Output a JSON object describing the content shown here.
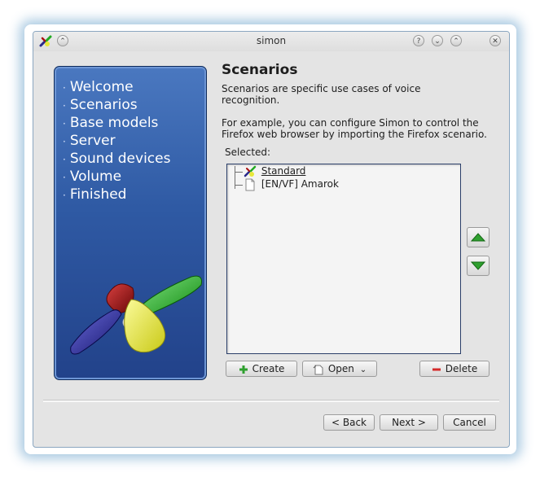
{
  "window": {
    "title": "simon"
  },
  "sidebar": {
    "steps": [
      "Welcome",
      "Scenarios",
      "Base models",
      "Server",
      "Sound devices",
      "Volume",
      "Finished"
    ]
  },
  "content": {
    "heading": "Scenarios",
    "description_line1": "Scenarios are specific use cases of voice",
    "description_line2": "recognition.",
    "example_line1": "For example, you can configure Simon to control the",
    "example_line2": "Firefox web browser by importing the Firefox scenario.",
    "selected_label": "Selected:",
    "tree": [
      {
        "label": "Standard",
        "icon": "simon-icon"
      },
      {
        "label": "[EN/VF] Amarok",
        "icon": "document-icon"
      }
    ]
  },
  "buttons": {
    "create": "Create",
    "open": "Open",
    "delete": "Delete",
    "back": "< Back",
    "next": "Next >",
    "cancel": "Cancel"
  },
  "colors": {
    "sidebar_top": "#4a78c0",
    "sidebar_bottom": "#22428a",
    "arrow_green": "#2fa02f",
    "delete_red": "#d42a2a"
  }
}
